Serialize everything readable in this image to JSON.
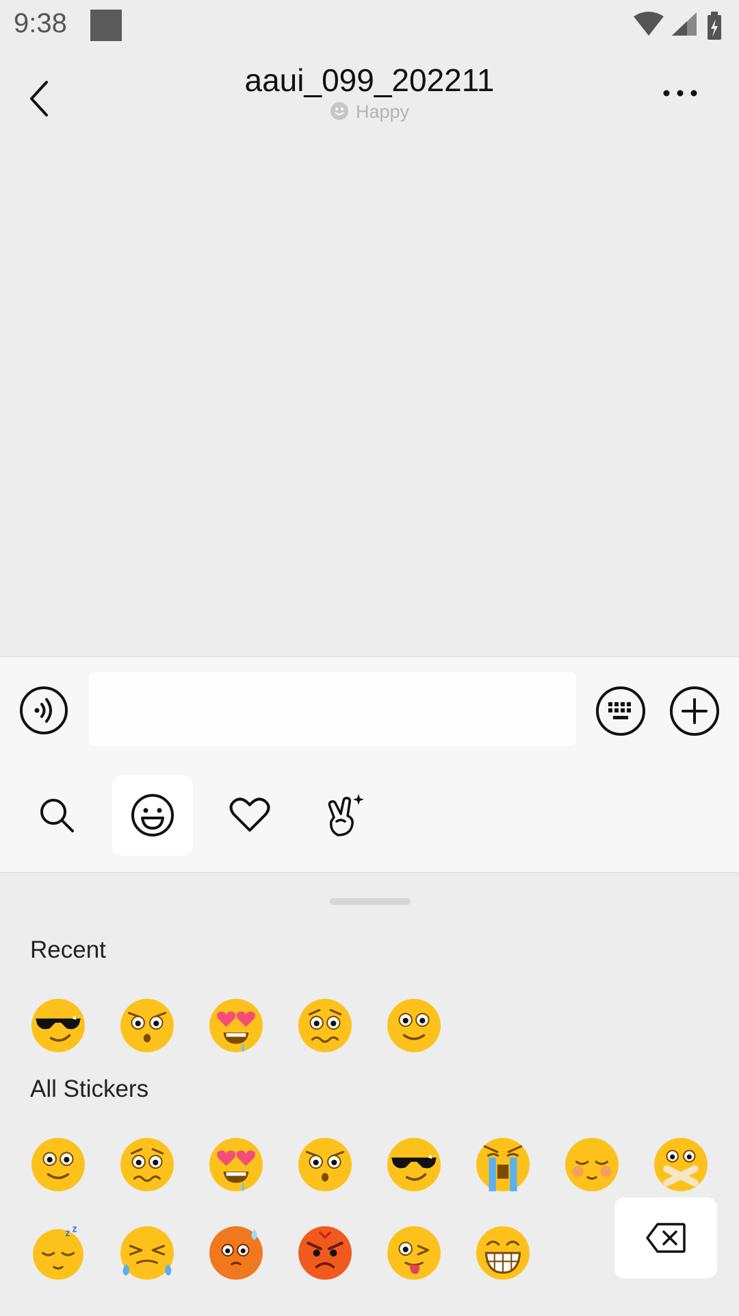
{
  "status_bar": {
    "time": "9:38"
  },
  "chat": {
    "title": "aaui_099_202211",
    "status": "Happy"
  },
  "composer": {
    "input_value": "",
    "input_placeholder": ""
  },
  "sticker_tabs": [
    {
      "name": "search-icon"
    },
    {
      "name": "smiley-icon",
      "active": true
    },
    {
      "name": "heart-icon"
    },
    {
      "name": "peace-hand-icon"
    }
  ],
  "sticker_panel": {
    "recent_label": "Recent",
    "all_label": "All Stickers",
    "recent": [
      "cool-sunglasses-emoji",
      "shocked-emoji",
      "heart-eyes-drool-emoji",
      "worried-emoji",
      "smile-emoji"
    ],
    "all_row1": [
      "smile-emoji",
      "worried-emoji",
      "heart-eyes-drool-emoji",
      "shocked-emoji",
      "cool-sunglasses-emoji",
      "crying-emoji",
      "blushing-emoji",
      "zipped-mouth-emoji"
    ],
    "all_row2": [
      "sleeping-emoji",
      "tears-of-joy-emoji",
      "sweating-red-emoji",
      "angry-emoji",
      "wink-tongue-emoji",
      "grin-emoji"
    ]
  },
  "colors": {
    "background": "#ededed",
    "composer": "#f7f7f7",
    "emoji_yellow": "#fcc21b",
    "emoji_orange": "#f0781e"
  }
}
